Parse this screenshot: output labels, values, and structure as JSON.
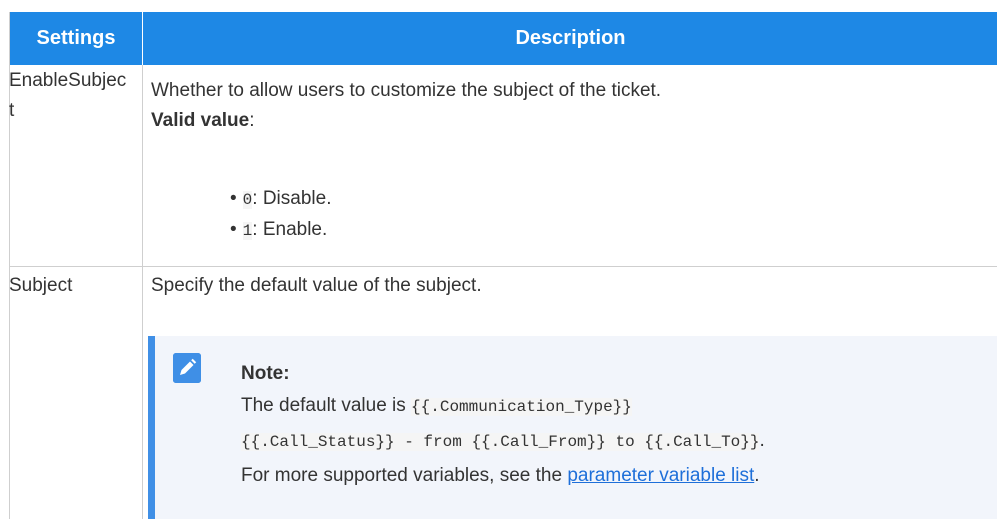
{
  "table": {
    "headers": [
      "Settings",
      "Description"
    ],
    "rows": [
      {
        "setting": "EnableSubject",
        "description": "Whether to allow users to customize the subject of the ticket.",
        "valid_label": "Valid value",
        "valid_colon": ":",
        "options": [
          {
            "code": "0",
            "text": ": Disable."
          },
          {
            "code": "1",
            "text": ": Enable."
          }
        ]
      },
      {
        "setting": "Subject",
        "description": "Specify the default value of the subject.",
        "note": {
          "icon": "pencil-icon",
          "title": "Note:",
          "line1_prefix": "The default value is ",
          "line1_code": "{{.Communication_Type}}",
          "line2_code": "{{.Call_Status}} - from {{.Call_From}} to {{.Call_To}}",
          "line2_suffix": ".",
          "line3_prefix": "For more supported variables, see the ",
          "link_text": "parameter variable list",
          "line3_suffix": "."
        }
      }
    ]
  },
  "colors": {
    "header_bg": "#1e88e5",
    "note_accent": "#3f8fe6",
    "note_bg": "#f2f5fb",
    "link": "#1e6fd9"
  }
}
